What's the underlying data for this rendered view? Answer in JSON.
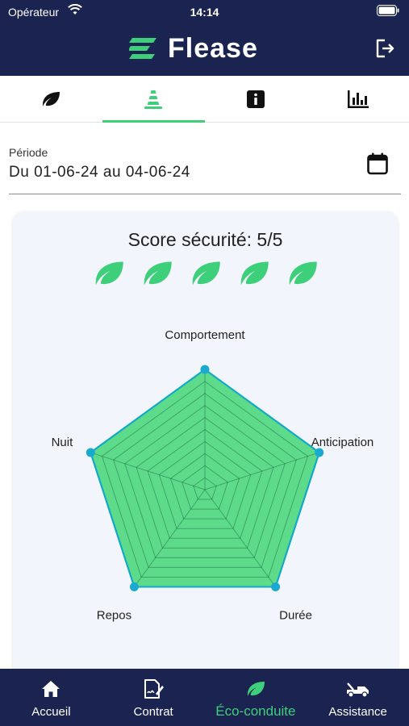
{
  "status_bar": {
    "carrier": "Opérateur",
    "time": "14:14"
  },
  "header": {
    "app_title": "Flease"
  },
  "tabs": [
    {
      "icon": "leaf-icon",
      "active": false
    },
    {
      "icon": "cone-icon",
      "active": true
    },
    {
      "icon": "info-icon",
      "active": false
    },
    {
      "icon": "bar-chart-icon",
      "active": false
    }
  ],
  "period": {
    "label": "Période",
    "value": "Du 01-06-24 au 04-06-24"
  },
  "score": {
    "title": "Score sécurité: 5/5",
    "leaf_count": 5
  },
  "chart_data": {
    "type": "radar",
    "categories": [
      "Comportement",
      "Anticipation",
      "Durée",
      "Repos",
      "Nuit"
    ],
    "values": [
      5,
      5,
      5,
      5,
      5
    ],
    "max": 5,
    "grid_levels": 10,
    "fill_color": "#5ddb8a",
    "line_color": "#12a8c9"
  },
  "bottom_nav": {
    "home": "Accueil",
    "contract": "Contrat",
    "eco": "Éco-conduite",
    "assistance": "Assistance"
  },
  "colors": {
    "brand_dark": "#1b2350",
    "accent_green": "#3ecf7a"
  }
}
